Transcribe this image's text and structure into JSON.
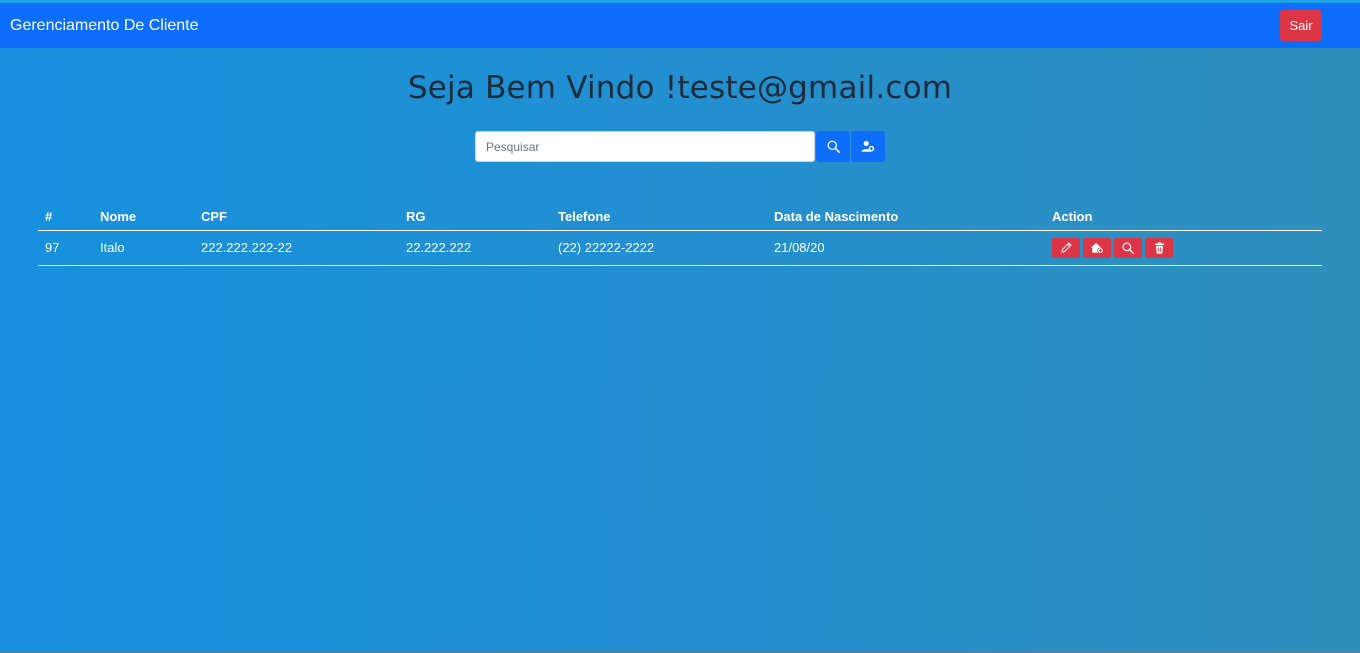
{
  "navbar": {
    "brand": "Gerenciamento De Cliente",
    "logout_label": "Sair"
  },
  "welcome": "Seja Bem Vindo !teste@gmail.com",
  "search": {
    "placeholder": "Pesquisar",
    "value": ""
  },
  "icons": {
    "search_button": "search-icon",
    "add_user_button": "person-add-icon",
    "edit": "pencil-icon",
    "address": "house-add-icon",
    "view": "search-icon",
    "delete": "trash-icon"
  },
  "colors": {
    "navbar": "#0d6efd",
    "danger": "#dc3545",
    "primary": "#0d6efd"
  },
  "table": {
    "headers": {
      "num": "#",
      "nome": "Nome",
      "cpf": "CPF",
      "rg": "RG",
      "telefone": "Telefone",
      "data": "Data de Nascimento",
      "action": "Action"
    },
    "rows": [
      {
        "num": "97",
        "nome": "Italo",
        "cpf": "222.222.222-22",
        "rg": "22.222.222",
        "telefone": "(22) 22222-2222",
        "data": "21/08/20"
      }
    ]
  }
}
